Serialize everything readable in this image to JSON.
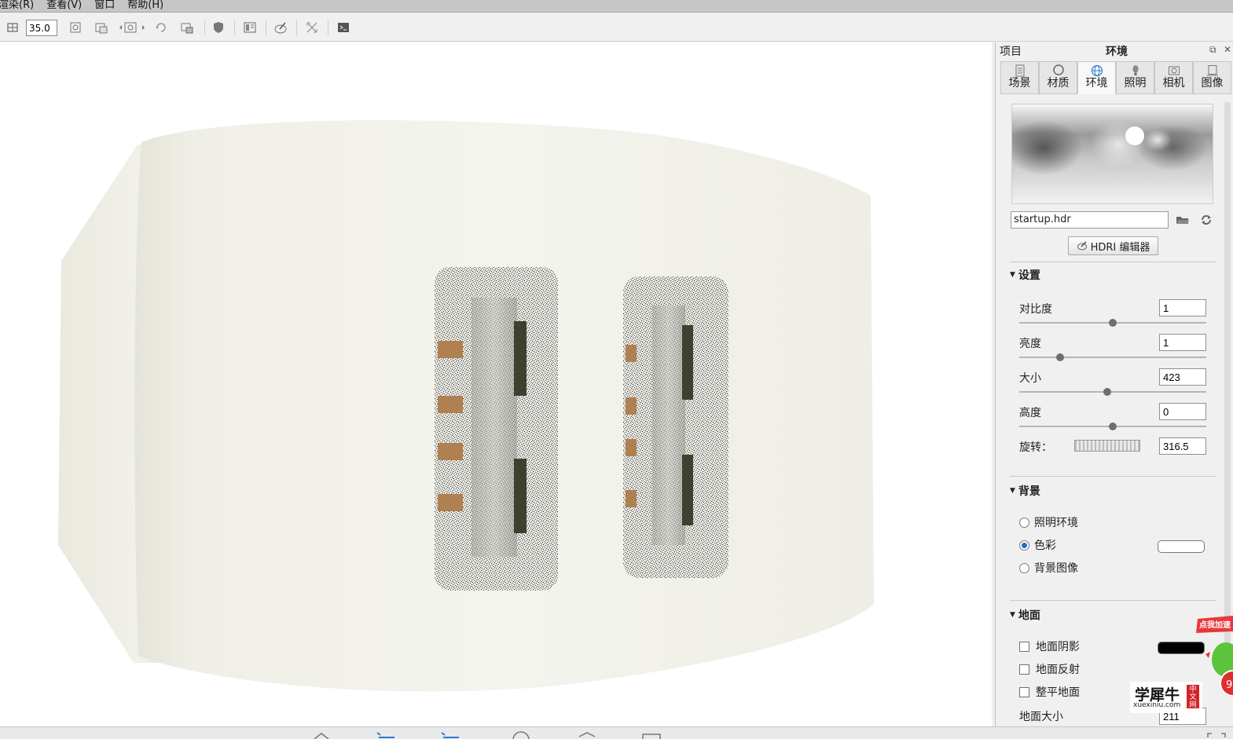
{
  "menubar": {
    "items": [
      "渲染(R)",
      "查看(V)",
      "窗口",
      "帮助(H)"
    ]
  },
  "toolbar": {
    "fov_value": "35.0",
    "icons": [
      "resolution-icon",
      "zoom-fit-icon",
      "region-render-icon",
      "screenshot-icon",
      "reset-view-icon",
      "lock-camera-icon",
      "shield-icon",
      "layout-icon",
      "paint-icon",
      "expand-icon",
      "terminal-icon"
    ]
  },
  "panel": {
    "project_label": "项目",
    "title": "环境",
    "tabs": [
      {
        "label": "场景",
        "icon": "list-icon"
      },
      {
        "label": "材质",
        "icon": "material-sphere-icon"
      },
      {
        "label": "环境",
        "icon": "globe-icon"
      },
      {
        "label": "照明",
        "icon": "bulb-icon"
      },
      {
        "label": "相机",
        "icon": "camera-icon"
      },
      {
        "label": "图像",
        "icon": "image-icon"
      }
    ],
    "active_tab": "环境",
    "hdr_file": "startup.hdr",
    "hdri_editor_label": "HDRI 编辑器",
    "settings": {
      "title": "设置",
      "contrast": {
        "label": "对比度",
        "value": "1",
        "slider": 0.5
      },
      "brightness": {
        "label": "亮度",
        "value": "1",
        "slider": 0.22
      },
      "size": {
        "label": "大小",
        "value": "423",
        "slider": 0.47
      },
      "height": {
        "label": "高度",
        "value": "0",
        "slider": 0.5
      },
      "rotation": {
        "label": "旋转：",
        "value": "316.5"
      }
    },
    "background": {
      "title": "背景",
      "options": [
        "照明环境",
        "色彩",
        "背景图像"
      ],
      "selected": "色彩",
      "color": "#ffffff"
    },
    "ground": {
      "title": "地面",
      "shadow_label": "地面阴影",
      "shadow_color": "#000000",
      "reflection_label": "地面反射",
      "flatten_label": "整平地面",
      "size_label": "地面大小",
      "size_value": "211"
    }
  },
  "overlay": {
    "promo_text": "点我加速",
    "promo_number": "9",
    "watermark_main": "学犀牛",
    "watermark_sub": "xuexiniu.com",
    "watermark_badge": "中文网"
  }
}
